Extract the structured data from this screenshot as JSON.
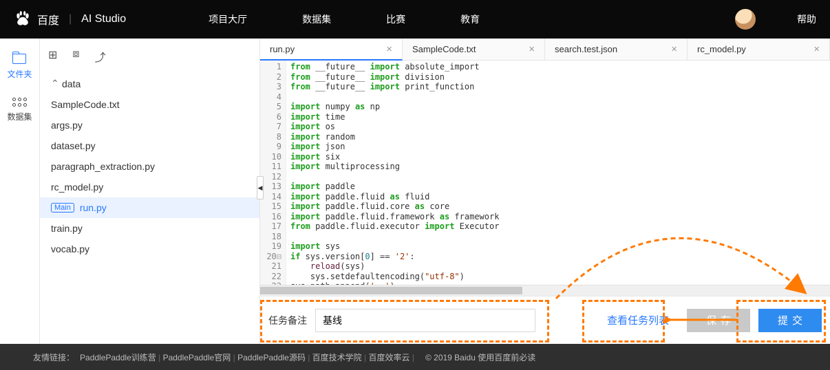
{
  "header": {
    "brand_cn": "百度",
    "brand_en": "AI Studio",
    "nav": [
      "项目大厅",
      "数据集",
      "比赛",
      "教育"
    ],
    "help": "帮助"
  },
  "rail": {
    "files": "文件夹",
    "datasets": "数据集"
  },
  "tree": {
    "folder": "data",
    "items": [
      "SampleCode.txt",
      "args.py",
      "dataset.py",
      "paragraph_extraction.py",
      "rc_model.py"
    ],
    "main_badge": "Main",
    "main_file": "run.py",
    "rest": [
      "train.py",
      "vocab.py"
    ]
  },
  "tabs": [
    {
      "label": "run.py",
      "active": true
    },
    {
      "label": "SampleCode.txt",
      "active": false
    },
    {
      "label": "search.test.json",
      "active": false
    },
    {
      "label": "rc_model.py",
      "active": false
    }
  ],
  "code": {
    "lines": 24,
    "raw": [
      {
        "t": "kw",
        "v": "from"
      },
      {
        "v": " __future__ "
      },
      {
        "t": "kw",
        "v": "import"
      },
      {
        "v": " absolute_import\n"
      },
      {
        "t": "kw",
        "v": "from"
      },
      {
        "v": " __future__ "
      },
      {
        "t": "kw",
        "v": "import"
      },
      {
        "v": " division\n"
      },
      {
        "t": "kw",
        "v": "from"
      },
      {
        "v": " __future__ "
      },
      {
        "t": "kw",
        "v": "import"
      },
      {
        "v": " print_function\n"
      },
      {
        "v": "\n"
      },
      {
        "t": "kw",
        "v": "import"
      },
      {
        "v": " numpy "
      },
      {
        "t": "kw",
        "v": "as"
      },
      {
        "v": " np\n"
      },
      {
        "t": "kw",
        "v": "import"
      },
      {
        "v": " time\n"
      },
      {
        "t": "kw",
        "v": "import"
      },
      {
        "v": " os\n"
      },
      {
        "t": "kw",
        "v": "import"
      },
      {
        "v": " random\n"
      },
      {
        "t": "kw",
        "v": "import"
      },
      {
        "v": " json\n"
      },
      {
        "t": "kw",
        "v": "import"
      },
      {
        "v": " six\n"
      },
      {
        "t": "kw",
        "v": "import"
      },
      {
        "v": " multiprocessing\n"
      },
      {
        "v": "\n"
      },
      {
        "t": "kw",
        "v": "import"
      },
      {
        "v": " paddle\n"
      },
      {
        "t": "kw",
        "v": "import"
      },
      {
        "v": " paddle.fluid "
      },
      {
        "t": "kw",
        "v": "as"
      },
      {
        "v": " fluid\n"
      },
      {
        "t": "kw",
        "v": "import"
      },
      {
        "v": " paddle.fluid.core "
      },
      {
        "t": "kw",
        "v": "as"
      },
      {
        "v": " core\n"
      },
      {
        "t": "kw",
        "v": "import"
      },
      {
        "v": " paddle.fluid.framework "
      },
      {
        "t": "kw",
        "v": "as"
      },
      {
        "v": " framework\n"
      },
      {
        "t": "kw",
        "v": "from"
      },
      {
        "v": " paddle.fluid.executor "
      },
      {
        "t": "kw",
        "v": "import"
      },
      {
        "v": " Executor\n"
      },
      {
        "v": "\n"
      },
      {
        "t": "kw",
        "v": "import"
      },
      {
        "v": " sys\n"
      },
      {
        "t": "kw",
        "v": "if"
      },
      {
        "v": " sys.version["
      },
      {
        "t": "nm",
        "v": "0"
      },
      {
        "v": "] == "
      },
      {
        "t": "st",
        "v": "'2'"
      },
      {
        "v": ":\n"
      },
      {
        "v": "    "
      },
      {
        "t": "bi",
        "v": "reload"
      },
      {
        "v": "(sys)\n"
      },
      {
        "v": "    sys.setdefaultencoding("
      },
      {
        "t": "st",
        "v": "\"utf-8\""
      },
      {
        "v": ")\n"
      },
      {
        "v": "sys.path.append("
      },
      {
        "t": "st",
        "v": "'..'"
      },
      {
        "v": ")\n"
      },
      {
        "v": ""
      }
    ]
  },
  "task": {
    "label": "任务备注",
    "value": "基线",
    "view_list": "查看任务列表",
    "save": "保存",
    "submit": "提交"
  },
  "footer": {
    "label": "友情链接：",
    "links": [
      "PaddlePaddle训练营",
      "PaddlePaddle官网",
      "PaddlePaddle源码",
      "百度技术学院",
      "百度效率云"
    ],
    "copy": "© 2019 Baidu 使用百度前必读"
  }
}
